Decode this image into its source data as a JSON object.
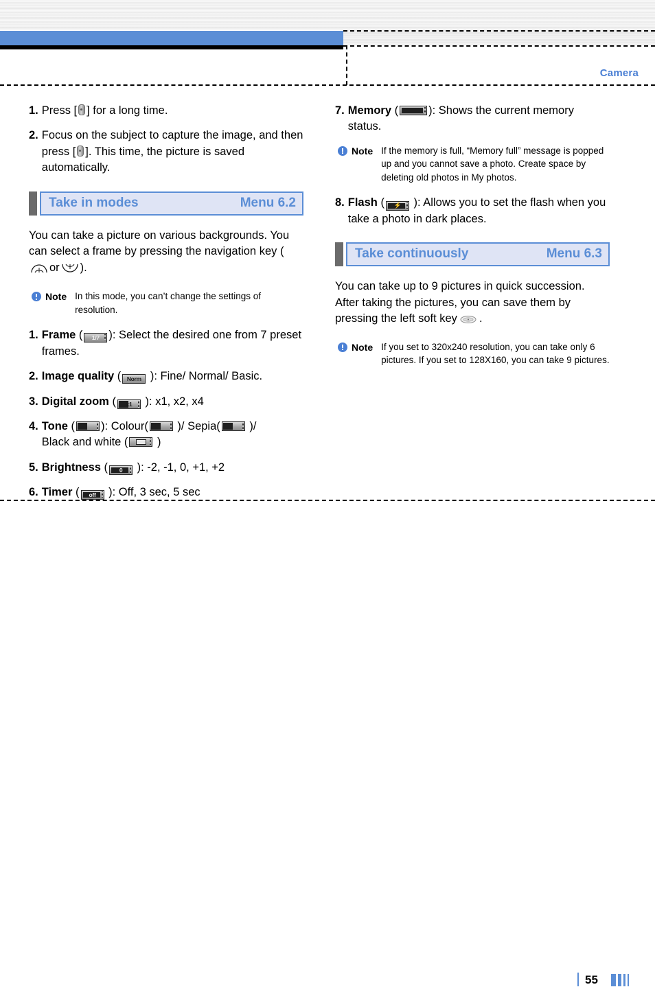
{
  "header": {
    "section_label": "Camera"
  },
  "footer": {
    "page_number": "55"
  },
  "left_column": {
    "steps": [
      {
        "num": "1.",
        "text_before": "Press [",
        "icon": "phone-key-icon",
        "text_after": "] for a long time."
      },
      {
        "num": "2.",
        "text_before": "Focus on the subject to capture the image, and then press [",
        "icon": "phone-key-icon",
        "text_after": "]. This time, the picture is saved automatically."
      }
    ],
    "section": {
      "title": "Take in modes",
      "menu": "Menu 6.2"
    },
    "intro_part1": "You can take a picture on various backgrounds. You can select a frame by pressing the navigation key (",
    "intro_or": "or",
    "intro_part2": ").",
    "note": {
      "label": "Note",
      "text": "In this mode, you can’t change the settings of resolution."
    },
    "options": [
      {
        "num": "1.",
        "name": "Frame",
        "icon_label": "1/7",
        "icon_name": "frame-indicator-icon",
        "text": "): Select the desired one from 7 preset frames.",
        "open_paren": " ("
      },
      {
        "num": "2.",
        "name": "Image quality",
        "icon_label": "Norm",
        "icon_name": "image-quality-indicator-icon",
        "text": " ): Fine/ Normal/ Basic.",
        "open_paren": " ("
      },
      {
        "num": "3.",
        "name": "Digital zoom",
        "icon_label": "x1",
        "icon_name": "digital-zoom-indicator-icon",
        "text": " ): x1, x2, x4",
        "open_paren": " ("
      },
      {
        "num": "5.",
        "name": "Brightness",
        "icon_label": "0",
        "icon_name": "brightness-indicator-icon",
        "text": " ): -2, -1, 0, +1, +2",
        "open_paren": " ("
      },
      {
        "num": "6.",
        "name": "Timer",
        "icon_label": "off",
        "icon_name": "timer-indicator-icon",
        "text": " ): Off, 3 sec, 5 sec",
        "open_paren": " ("
      }
    ],
    "tone": {
      "num": "4.",
      "name": "Tone",
      "t1": " (",
      "t2": "): Colour(",
      "t3": " )/ Sepia(",
      "t4": " )/",
      "t5": "Black and white (",
      "t6": " )"
    }
  },
  "right_column": {
    "memory": {
      "num": "7.",
      "name": "Memory",
      "t1": " (",
      "t2": "): Shows the current memory status."
    },
    "memory_note": {
      "label": "Note",
      "text": "If the memory is full, “Memory full” message is popped up and you cannot save a photo. Create space by deleting old photos in My photos."
    },
    "flash": {
      "num": "8.",
      "name": "Flash",
      "t1": " (",
      "t2": " ): Allows you to set the flash when you take a photo in dark places."
    },
    "section": {
      "title": "Take continuously",
      "menu": "Menu 6.3"
    },
    "intro_part1": "You can take up to 9 pictures in quick succession. After taking the pictures, you can save them by pressing the left soft key",
    "intro_part2": ".",
    "note": {
      "label": "Note",
      "text": "If you set to 320x240 resolution, you can take only 6 pictures. If you set to 128X160, you can take 9 pictures."
    }
  },
  "colors": {
    "accent_blue": "#5b8ed6",
    "header_blue": "#4a7fd4",
    "band_bg": "#dfe4f5",
    "tab_gray": "#6b6b6b"
  }
}
